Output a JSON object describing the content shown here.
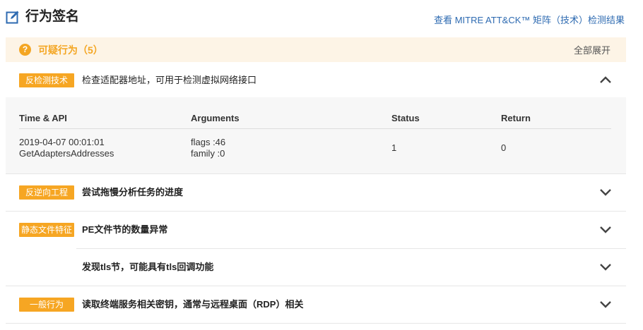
{
  "header": {
    "title": "行为签名",
    "title_icon": "edit-icon",
    "mitre_link": "查看 MITRE ATT&CK™ 矩阵（技术）检测结果"
  },
  "summary": {
    "label": "可疑行为（5）",
    "expand_all": "全部展开",
    "icon": "question-icon"
  },
  "items": [
    {
      "tag": "反检测技术",
      "text": "检查适配器地址，可用于检测虚拟网络接口",
      "expanded": true
    },
    {
      "tag": "反逆向工程",
      "text": "尝试拖慢分析任务的进度",
      "expanded": false
    },
    {
      "tag": "静态文件特征",
      "text": "PE文件节的数量异常",
      "expanded": false
    },
    {
      "tag": "",
      "text": "发现tls节，可能具有tls回调功能",
      "expanded": false
    },
    {
      "tag": "一般行为",
      "text": "读取终端服务相关密钥，通常与远程桌面（RDP）相关",
      "expanded": false
    }
  ],
  "detail_table": {
    "columns": [
      "Time & API",
      "Arguments",
      "Status",
      "Return"
    ],
    "rows": [
      {
        "time": "2019-04-07 00:01:01",
        "api": "GetAdaptersAddresses",
        "arg1": "flags :46",
        "arg2": "family :0",
        "status": "1",
        "return": "0"
      }
    ]
  },
  "colors": {
    "accent_orange": "#f6a623",
    "link_blue": "#2d6ab1",
    "summary_bg": "#fdf4e6",
    "detail_bg": "#f7f7f7"
  }
}
